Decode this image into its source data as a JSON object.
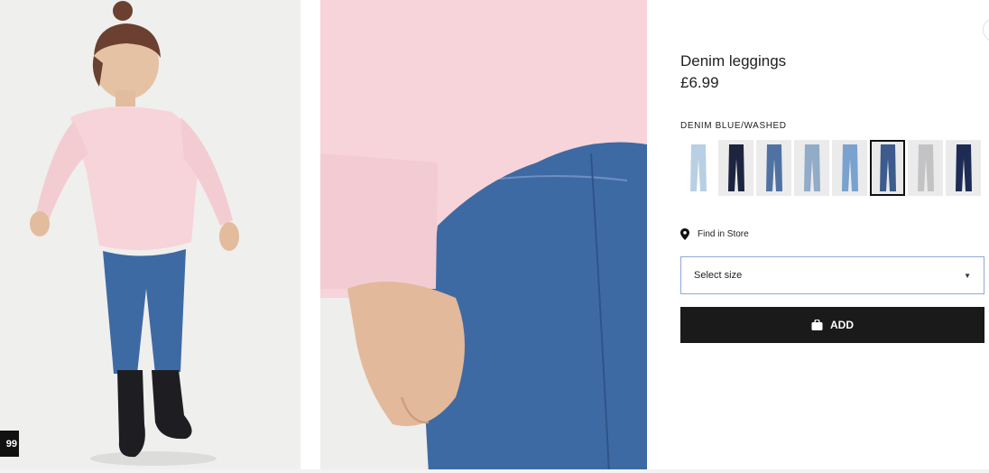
{
  "product": {
    "title": "Denim leggings",
    "price": "£6.99",
    "color_name": "DENIM BLUE/WASHED"
  },
  "swatches": [
    {
      "color": "#b9cfe3",
      "selected": false
    },
    {
      "color": "#1c2440",
      "selected": false
    },
    {
      "color": "#4f72a2",
      "selected": false
    },
    {
      "color": "#91abc8",
      "selected": false
    },
    {
      "color": "#7aa2cf",
      "selected": false
    },
    {
      "color": "#3d5b8c",
      "selected": true
    },
    {
      "color": "#c3c3c5",
      "selected": false
    },
    {
      "color": "#1e2c55",
      "selected": false
    }
  ],
  "find_in_store": {
    "label": "Find in Store",
    "icon": "location-pin-icon"
  },
  "size_select": {
    "value": "Select size"
  },
  "add_button": {
    "label": "ADD",
    "icon": "shopping-bag-icon"
  },
  "image_badge": {
    "text": "99"
  },
  "colors": {
    "accent": "#1a1a1a",
    "select_border": "#8fa8dc",
    "sweater": "#f5cfd4",
    "denim": "#3e6aa4"
  }
}
